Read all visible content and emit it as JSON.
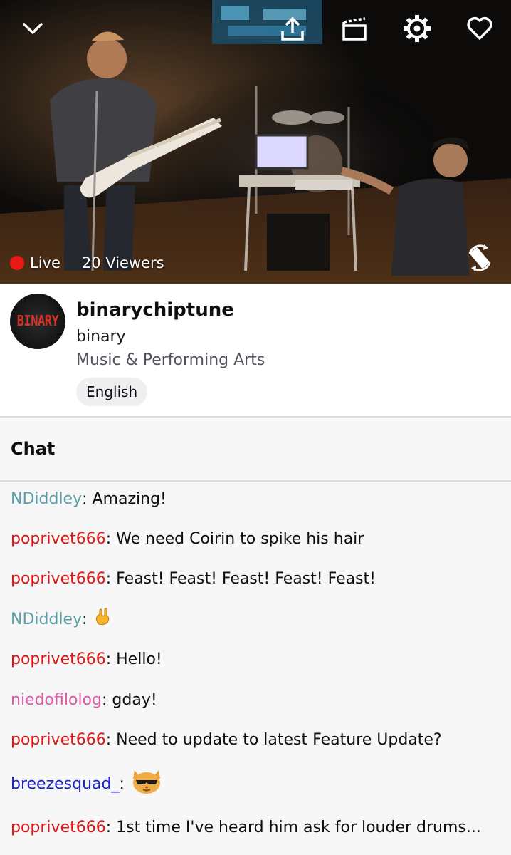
{
  "player": {
    "live_label": "Live",
    "viewers_label": "20 Viewers"
  },
  "icons": {
    "collapse": "chevron-down-icon",
    "share": "share-icon",
    "clip": "clapperboard-icon",
    "settings": "gear-icon",
    "follow": "heart-icon",
    "rotate": "rotate-screen-icon"
  },
  "channel": {
    "avatar_text": "BINARY",
    "name": "binarychiptune",
    "title": "binary",
    "category": "Music & Performing Arts",
    "tag": "English"
  },
  "chat": {
    "header": "Chat",
    "messages": [
      {
        "user": "NDiddley",
        "text": "Amazing!",
        "color": "#5a9ea6"
      },
      {
        "user": "poprivet666",
        "text": "We need Coirin to spike his hair",
        "color": "#e01414"
      },
      {
        "user": "poprivet666",
        "text": "Feast! Feast! Feast! Feast! Feast!",
        "color": "#e01414"
      },
      {
        "user": "NDiddley",
        "text": "",
        "emote": "rock-hand-emote",
        "color": "#5a9ea6"
      },
      {
        "user": "poprivet666",
        "text": "Hello!",
        "color": "#e01414"
      },
      {
        "user": "niedofilolog",
        "text": "gday!",
        "color": "#e05aa8"
      },
      {
        "user": "poprivet666",
        "text": "Need to update to latest Feature Update?",
        "color": "#e01414"
      },
      {
        "user": "breezesquad_",
        "text": "",
        "emote": "cool-cat-emote",
        "color": "#1a22c8"
      },
      {
        "user": "poprivet666",
        "text": "1st time I've heard him ask for louder drums...",
        "color": "#e01414"
      }
    ]
  },
  "colors": {
    "live_red": "#e91916",
    "accent_purple": "#9147ff"
  }
}
